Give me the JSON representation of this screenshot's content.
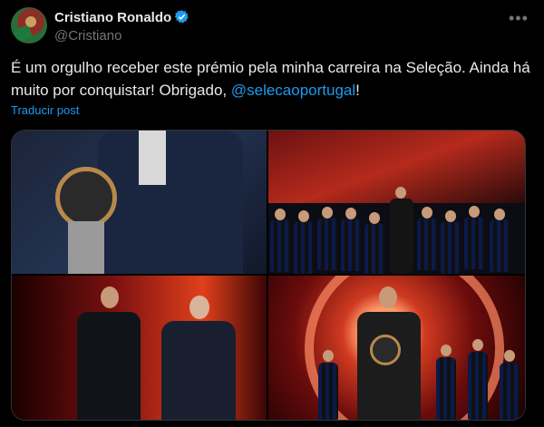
{
  "author": {
    "name": "Cristiano Ronaldo",
    "handle": "@Cristiano"
  },
  "tweet": {
    "text": "É um orgulho receber este prémio pela minha carreira na Seleção. Ainda há muito por conquistar! Obrigado, ",
    "mention": "@selecaoportugal",
    "text_end": "!"
  },
  "translate_label": "Traducir post",
  "icons": {
    "verified": "verified-badge-icon",
    "more": "more-options-icon"
  },
  "colors": {
    "accent": "#1d9bf0",
    "bg": "#000000",
    "muted": "#71767b"
  }
}
